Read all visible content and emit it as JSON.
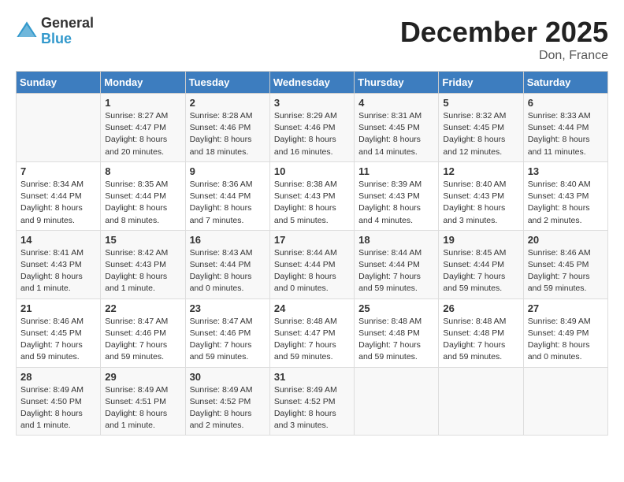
{
  "header": {
    "logo_general": "General",
    "logo_blue": "Blue",
    "month_title": "December 2025",
    "location": "Don, France"
  },
  "days_of_week": [
    "Sunday",
    "Monday",
    "Tuesday",
    "Wednesday",
    "Thursday",
    "Friday",
    "Saturday"
  ],
  "weeks": [
    [
      {
        "day": "",
        "info": ""
      },
      {
        "day": "1",
        "info": "Sunrise: 8:27 AM\nSunset: 4:47 PM\nDaylight: 8 hours\nand 20 minutes."
      },
      {
        "day": "2",
        "info": "Sunrise: 8:28 AM\nSunset: 4:46 PM\nDaylight: 8 hours\nand 18 minutes."
      },
      {
        "day": "3",
        "info": "Sunrise: 8:29 AM\nSunset: 4:46 PM\nDaylight: 8 hours\nand 16 minutes."
      },
      {
        "day": "4",
        "info": "Sunrise: 8:31 AM\nSunset: 4:45 PM\nDaylight: 8 hours\nand 14 minutes."
      },
      {
        "day": "5",
        "info": "Sunrise: 8:32 AM\nSunset: 4:45 PM\nDaylight: 8 hours\nand 12 minutes."
      },
      {
        "day": "6",
        "info": "Sunrise: 8:33 AM\nSunset: 4:44 PM\nDaylight: 8 hours\nand 11 minutes."
      }
    ],
    [
      {
        "day": "7",
        "info": "Sunrise: 8:34 AM\nSunset: 4:44 PM\nDaylight: 8 hours\nand 9 minutes."
      },
      {
        "day": "8",
        "info": "Sunrise: 8:35 AM\nSunset: 4:44 PM\nDaylight: 8 hours\nand 8 minutes."
      },
      {
        "day": "9",
        "info": "Sunrise: 8:36 AM\nSunset: 4:44 PM\nDaylight: 8 hours\nand 7 minutes."
      },
      {
        "day": "10",
        "info": "Sunrise: 8:38 AM\nSunset: 4:43 PM\nDaylight: 8 hours\nand 5 minutes."
      },
      {
        "day": "11",
        "info": "Sunrise: 8:39 AM\nSunset: 4:43 PM\nDaylight: 8 hours\nand 4 minutes."
      },
      {
        "day": "12",
        "info": "Sunrise: 8:40 AM\nSunset: 4:43 PM\nDaylight: 8 hours\nand 3 minutes."
      },
      {
        "day": "13",
        "info": "Sunrise: 8:40 AM\nSunset: 4:43 PM\nDaylight: 8 hours\nand 2 minutes."
      }
    ],
    [
      {
        "day": "14",
        "info": "Sunrise: 8:41 AM\nSunset: 4:43 PM\nDaylight: 8 hours\nand 1 minute."
      },
      {
        "day": "15",
        "info": "Sunrise: 8:42 AM\nSunset: 4:43 PM\nDaylight: 8 hours\nand 1 minute."
      },
      {
        "day": "16",
        "info": "Sunrise: 8:43 AM\nSunset: 4:44 PM\nDaylight: 8 hours\nand 0 minutes."
      },
      {
        "day": "17",
        "info": "Sunrise: 8:44 AM\nSunset: 4:44 PM\nDaylight: 8 hours\nand 0 minutes."
      },
      {
        "day": "18",
        "info": "Sunrise: 8:44 AM\nSunset: 4:44 PM\nDaylight: 7 hours\nand 59 minutes."
      },
      {
        "day": "19",
        "info": "Sunrise: 8:45 AM\nSunset: 4:44 PM\nDaylight: 7 hours\nand 59 minutes."
      },
      {
        "day": "20",
        "info": "Sunrise: 8:46 AM\nSunset: 4:45 PM\nDaylight: 7 hours\nand 59 minutes."
      }
    ],
    [
      {
        "day": "21",
        "info": "Sunrise: 8:46 AM\nSunset: 4:45 PM\nDaylight: 7 hours\nand 59 minutes."
      },
      {
        "day": "22",
        "info": "Sunrise: 8:47 AM\nSunset: 4:46 PM\nDaylight: 7 hours\nand 59 minutes."
      },
      {
        "day": "23",
        "info": "Sunrise: 8:47 AM\nSunset: 4:46 PM\nDaylight: 7 hours\nand 59 minutes."
      },
      {
        "day": "24",
        "info": "Sunrise: 8:48 AM\nSunset: 4:47 PM\nDaylight: 7 hours\nand 59 minutes."
      },
      {
        "day": "25",
        "info": "Sunrise: 8:48 AM\nSunset: 4:48 PM\nDaylight: 7 hours\nand 59 minutes."
      },
      {
        "day": "26",
        "info": "Sunrise: 8:48 AM\nSunset: 4:48 PM\nDaylight: 7 hours\nand 59 minutes."
      },
      {
        "day": "27",
        "info": "Sunrise: 8:49 AM\nSunset: 4:49 PM\nDaylight: 8 hours\nand 0 minutes."
      }
    ],
    [
      {
        "day": "28",
        "info": "Sunrise: 8:49 AM\nSunset: 4:50 PM\nDaylight: 8 hours\nand 1 minute."
      },
      {
        "day": "29",
        "info": "Sunrise: 8:49 AM\nSunset: 4:51 PM\nDaylight: 8 hours\nand 1 minute."
      },
      {
        "day": "30",
        "info": "Sunrise: 8:49 AM\nSunset: 4:52 PM\nDaylight: 8 hours\nand 2 minutes."
      },
      {
        "day": "31",
        "info": "Sunrise: 8:49 AM\nSunset: 4:52 PM\nDaylight: 8 hours\nand 3 minutes."
      },
      {
        "day": "",
        "info": ""
      },
      {
        "day": "",
        "info": ""
      },
      {
        "day": "",
        "info": ""
      }
    ]
  ]
}
